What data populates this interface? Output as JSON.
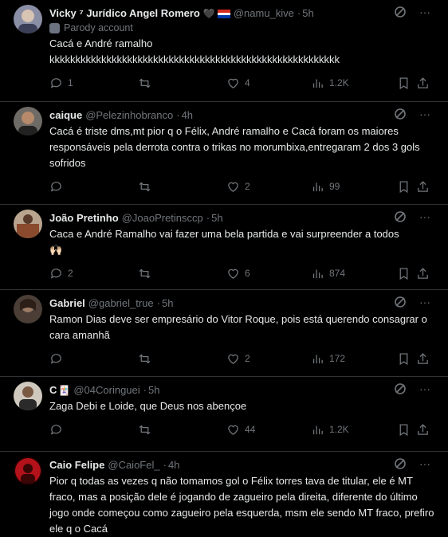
{
  "tweets": [
    {
      "name": "Vicky ⁷ Jurídico Angel Romero",
      "badge": "🖤",
      "handle": "@namu_kive",
      "time": "5h",
      "parody": "Parody account",
      "text": "Cacá e André ramalho\nkkkkkkkkkkkkkkkkkkkkkkkkkkkkkkkkkkkkkkkkkkkkkkkkkkkkkkkk",
      "replies": "1",
      "retweets": "",
      "likes": "4",
      "views": "1.2K"
    },
    {
      "name": "caique",
      "handle": "@Pelezinhobranco",
      "time": "4h",
      "text": "Cacá é triste dms,mt pior q o Félix, André ramalho e Cacá foram os maiores responsáveis pela derrota contra o trikas no morumbixa,entregaram 2 dos 3 gols sofridos",
      "replies": "",
      "retweets": "",
      "likes": "2",
      "views": "99"
    },
    {
      "name": "João Pretinho",
      "handle": "@JoaoPretinsccp",
      "time": "5h",
      "text": "Caca e André Ramalho vai fazer uma bela partida e vai surpreender a todos\n🙌🏻",
      "replies": "2",
      "retweets": "",
      "likes": "6",
      "views": "874"
    },
    {
      "name": "Gabriel",
      "handle": "@gabriel_true",
      "time": "5h",
      "text": "Ramon Dias deve ser empresário do Vitor Roque, pois está querendo consagrar o cara amanhã",
      "replies": "",
      "retweets": "",
      "likes": "2",
      "views": "172"
    },
    {
      "name": "C",
      "badge": "🃏",
      "handle": "@04Coringuei",
      "time": "5h",
      "text": "Zaga Debi e Loide, que Deus nos abençoe",
      "replies": "",
      "retweets": "",
      "likes": "44",
      "views": "1.2K"
    },
    {
      "name": "Caio Felipe",
      "handle": "@CaioFel_",
      "time": "4h",
      "text": "Pior q todas as vezes q não tomamos gol o Félix torres tava de titular, ele é MT fraco, mas a posição dele é jogando de zagueiro pela direita, diferente do último jogo onde começou como zagueiro pela esquerda, msm ele sendo MT fraco, prefiro ele q o Cacá"
    }
  ],
  "colors": {
    "background": "#000000",
    "text": "#e7e9ea",
    "muted": "#71767b",
    "divider": "#2f3336"
  },
  "icons": [
    "reply-icon",
    "retweet-icon",
    "like-icon",
    "views-icon",
    "bookmark-icon",
    "share-icon",
    "grok-icon",
    "more-icon"
  ]
}
